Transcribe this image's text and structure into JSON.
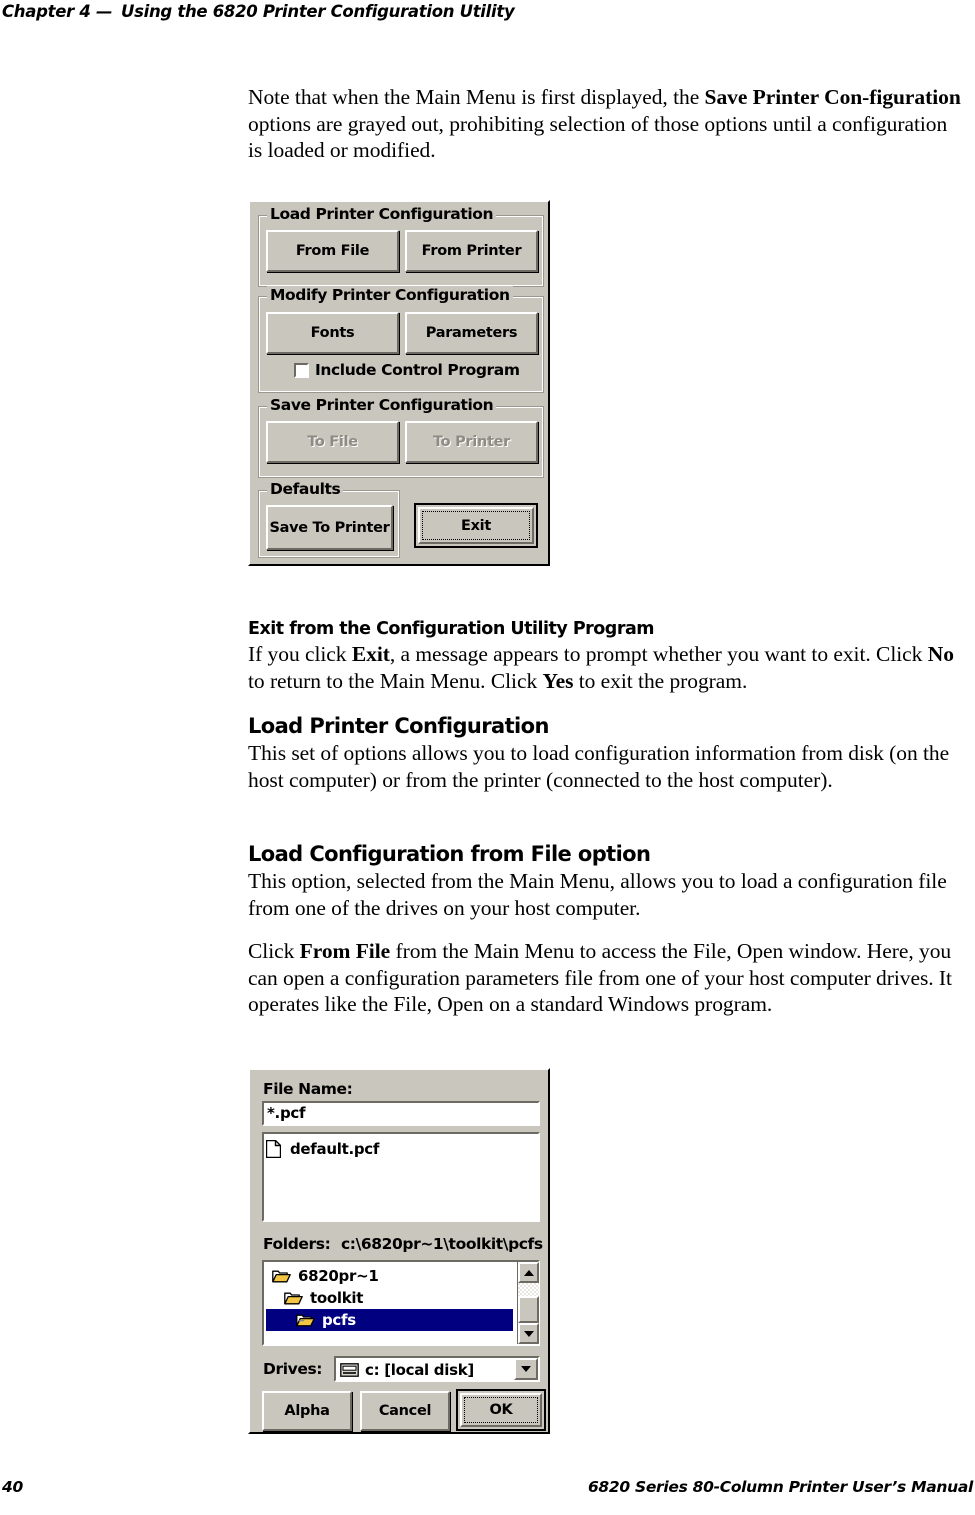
{
  "running_head": {
    "chapter": "Chapter 4",
    "dash": "—",
    "title": "Using the 6820 Printer Configuration Utility"
  },
  "running_foot": {
    "page_number": "40",
    "manual_title": "6820 Series 80-Column Printer User’s Manual"
  },
  "intro_paragraph": {
    "part1": "Note that when the Main Menu is first displayed, the ",
    "bold1": "Save Printer Con-figuration",
    "part2": " options are grayed out, prohibiting selection of those options until a configuration is loaded or modified."
  },
  "main_menu_dialog": {
    "groups": [
      {
        "title": "Load Printer Configuration",
        "buttons": [
          {
            "label": "From File",
            "disabled": false
          },
          {
            "label": "From Printer",
            "disabled": false
          }
        ]
      },
      {
        "title": "Modify Printer Configuration",
        "buttons": [
          {
            "label": "Fonts",
            "disabled": false
          },
          {
            "label": "Parameters",
            "disabled": false
          }
        ],
        "checkbox": {
          "label": "Include Control Program",
          "checked": false
        }
      },
      {
        "title": "Save Printer Configuration",
        "buttons": [
          {
            "label": "To File",
            "disabled": true
          },
          {
            "label": "To Printer",
            "disabled": true
          }
        ]
      },
      {
        "title": "Defaults",
        "buttons": [
          {
            "label": "Save To Printer",
            "disabled": false
          }
        ]
      }
    ],
    "exit_button": {
      "label": "Exit",
      "default_focus": true
    }
  },
  "sections": [
    {
      "heading": "Exit from the Configuration Utility Program",
      "paragraphs": [
        {
          "runs": [
            {
              "text": "If you click ",
              "bold": false
            },
            {
              "text": "Exit",
              "bold": true
            },
            {
              "text": ", a message appears to prompt whether you want to exit. Click ",
              "bold": false
            },
            {
              "text": "No",
              "bold": true
            },
            {
              "text": " to return to the Main Menu. Click ",
              "bold": false
            },
            {
              "text": "Yes",
              "bold": true
            },
            {
              "text": " to exit the program.",
              "bold": false
            }
          ]
        }
      ]
    },
    {
      "heading": "Load Printer Configuration",
      "paragraphs": [
        {
          "runs": [
            {
              "text": "This set of options allows you to load configuration information from disk (on the host computer) or from the printer (connected to the host computer).",
              "bold": false
            }
          ]
        }
      ]
    },
    {
      "heading": "Load Configuration from File option",
      "paragraphs": [
        {
          "runs": [
            {
              "text": "This option, selected from the Main Menu, allows you to load a configuration file from one of the drives on your host computer.",
              "bold": false
            }
          ]
        },
        {
          "runs": [
            {
              "text": "Click ",
              "bold": false
            },
            {
              "text": "From File",
              "bold": true
            },
            {
              "text": " from the Main Menu to access the File, Open window. Here, you can open a configuration parameters file from one of your host computer drives. It operates like the File, Open on a standard Windows program.",
              "bold": false
            }
          ]
        }
      ]
    }
  ],
  "file_open_dialog": {
    "file_name_label": "File Name:",
    "file_name_value": "*.pcf",
    "file_list": [
      {
        "name": "default.pcf",
        "icon": "document-icon",
        "selected": false
      }
    ],
    "folders_label": "Folders:",
    "folders_path": "c:\\6820pr~1\\toolkit\\pcfs",
    "folder_tree": [
      {
        "name": "6820pr~1",
        "indent": 0,
        "icon": "folder-closed-icon",
        "selected": false
      },
      {
        "name": "toolkit",
        "indent": 1,
        "icon": "folder-closed-icon",
        "selected": false
      },
      {
        "name": "pcfs",
        "indent": 2,
        "icon": "folder-open-icon",
        "selected": true
      }
    ],
    "drives_label": "Drives:",
    "drives_value": "c: [local disk]",
    "drives_icon": "drive-icon",
    "buttons": [
      {
        "label": "Alpha",
        "default_focus": false
      },
      {
        "label": "Cancel",
        "default_focus": false
      },
      {
        "label": "OK",
        "default_focus": true
      }
    ],
    "scrollbar": {
      "up_icon": "scroll-up-arrow-icon",
      "down_icon": "scroll-down-arrow-icon"
    },
    "dropdown_icon": "chevron-down-icon"
  },
  "colors": {
    "dialog_face": "#c9c6bd",
    "selection": "#000080",
    "disabled_text": "#8e8b84",
    "field_background": "#ffffff"
  }
}
